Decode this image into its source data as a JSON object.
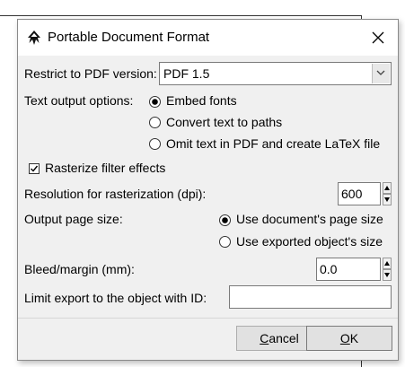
{
  "window": {
    "title": "Portable Document Format",
    "icon": "inkscape-logo-icon",
    "close_icon": "close-icon"
  },
  "pdf_version": {
    "label": "Restrict to PDF version:",
    "value": "PDF 1.5"
  },
  "text_output": {
    "label": "Text output options:",
    "options": [
      {
        "label": "Embed fonts",
        "selected": true
      },
      {
        "label": "Convert text to paths",
        "selected": false
      },
      {
        "label": "Omit text in PDF and create LaTeX file",
        "selected": false
      }
    ]
  },
  "rasterize": {
    "label": "Rasterize filter effects",
    "checked": true
  },
  "resolution": {
    "label": "Resolution for rasterization (dpi):",
    "value": "600"
  },
  "page_size": {
    "label": "Output page size:",
    "options": [
      {
        "label": "Use document's page size",
        "selected": true
      },
      {
        "label": "Use exported object's size",
        "selected": false
      }
    ]
  },
  "bleed": {
    "label": "Bleed/margin (mm):",
    "value": "0.0"
  },
  "limit_id": {
    "label": "Limit export to the object with ID:",
    "value": ""
  },
  "buttons": {
    "cancel_first": "C",
    "cancel_rest": "ancel",
    "ok_first": "O",
    "ok_rest": "K"
  }
}
